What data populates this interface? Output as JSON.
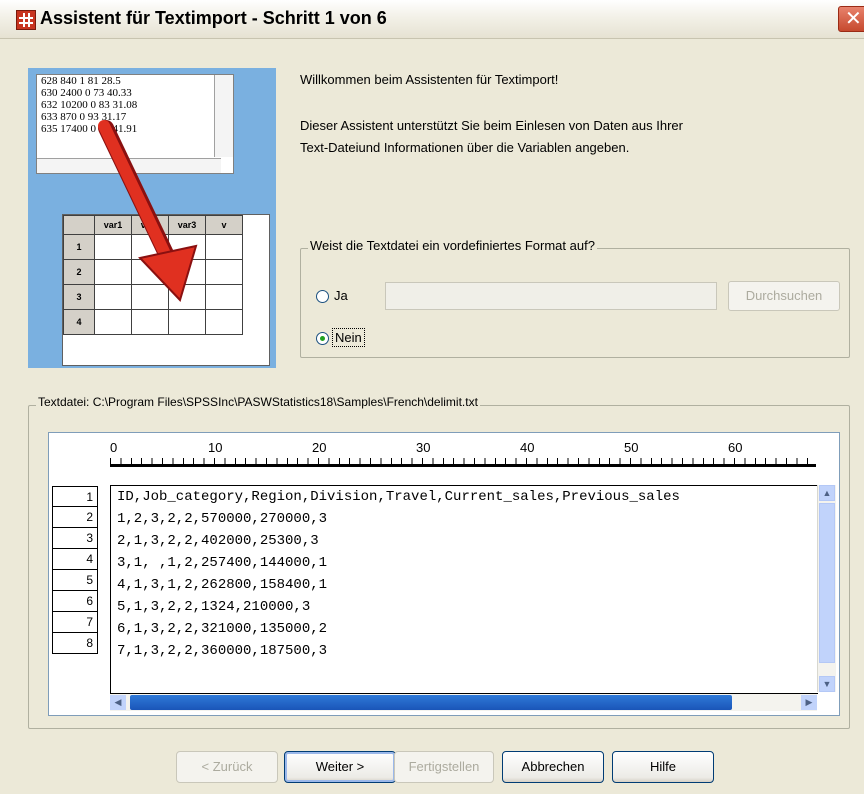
{
  "window": {
    "title": "Assistent für Textimport - Schritt 1 von 6",
    "close_glyph": "✕"
  },
  "illustration": {
    "sample_lines": [
      "628 840 1 81 28.5",
      "630 2400 0 73 40.33",
      "632 10200 0 83 31.08",
      "633 870 0 93 31.17",
      "635 17400 0 83 41.91"
    ],
    "grid_headers": [
      "var1",
      "var2",
      "var3",
      "v"
    ],
    "grid_rows": [
      "1",
      "2",
      "3",
      "4"
    ]
  },
  "intro": {
    "welcome": "Willkommen beim Assistenten für Textimport!",
    "desc_line1": "Dieser Assistent unterstützt Sie beim Einlesen von Daten aus Ihrer",
    "desc_line2": "Text-Dateiund Informationen über die Variablen angeben."
  },
  "format_group": {
    "legend": "Weist die Textdatei ein vordefiniertes Format auf?",
    "option_yes": "Ja",
    "option_no": "Nein",
    "selected": "Nein",
    "format_value": "",
    "browse_label": "Durchsuchen"
  },
  "textfile": {
    "legend": "Textdatei: C:\\Program Files\\SPSSInc\\PASWStatistics18\\Samples\\French\\delimit.txt",
    "ruler_labels": [
      "0",
      "10",
      "20",
      "30",
      "40",
      "50",
      "60"
    ],
    "line_numbers": [
      "1",
      "2",
      "3",
      "4",
      "5",
      "6",
      "7",
      "8"
    ],
    "lines": [
      "ID,Job_category,Region,Division,Travel,Current_sales,Previous_sales",
      "1,2,3,2,2,570000,270000,3",
      "2,1,3,2,2,402000,25300,3",
      "3,1, ,1,2,257400,144000,1",
      "4,1,3,1,2,262800,158400,1",
      "5,1,3,2,2,1324,210000,3",
      "6,1,3,2,2,321000,135000,2",
      "7,1,3,2,2,360000,187500,3"
    ]
  },
  "buttons": {
    "back": "< Zurück",
    "next": "Weiter >",
    "finish": "Fertigstellen",
    "cancel": "Abbrechen",
    "help": "Hilfe"
  }
}
